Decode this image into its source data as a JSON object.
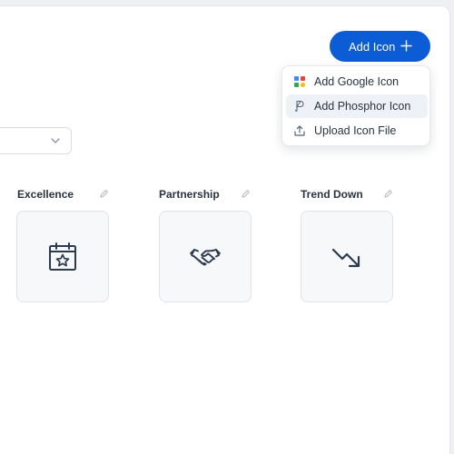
{
  "header": {
    "add_icon_label": "Add Icon"
  },
  "menu": {
    "items": [
      {
        "label": "Add Google Icon",
        "icon": "google-color-icon"
      },
      {
        "label": "Add Phosphor Icon",
        "icon": "phosphor-icon"
      },
      {
        "label": "Upload Icon File",
        "icon": "upload-icon"
      }
    ]
  },
  "filter": {
    "value": ""
  },
  "icons": [
    {
      "label": "Excellence",
      "icon": "calendar-star-icon"
    },
    {
      "label": "Partnership",
      "icon": "handshake-icon"
    },
    {
      "label": "Trend Down",
      "icon": "trend-down-icon"
    }
  ],
  "colors": {
    "accent": "#0b5cd5",
    "icon_stroke": "#2b3a4d"
  }
}
